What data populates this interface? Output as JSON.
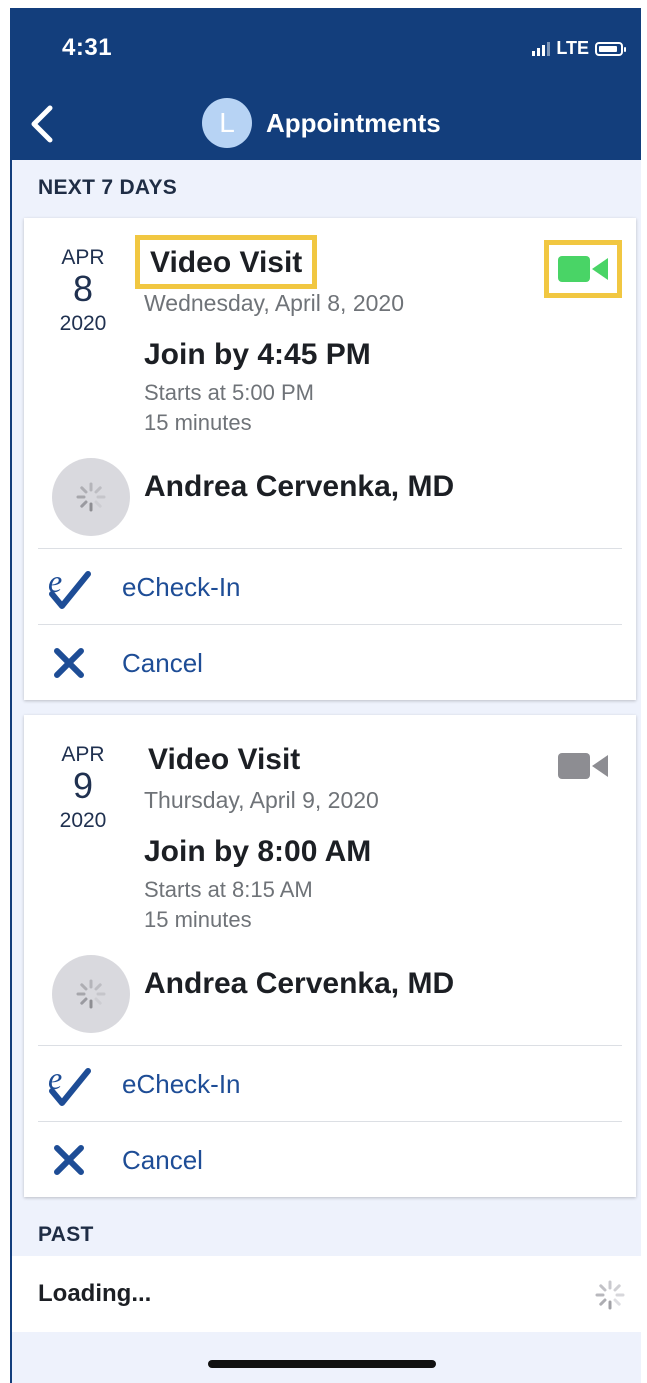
{
  "status_bar": {
    "time": "4:31",
    "network": "LTE"
  },
  "nav": {
    "avatar_letter": "L",
    "title": "Appointments"
  },
  "sections": {
    "upcoming_label": "NEXT 7 DAYS",
    "past_label": "PAST"
  },
  "appointments": [
    {
      "month": "APR",
      "day": "8",
      "year": "2020",
      "title": "Video Visit",
      "date_text": "Wednesday, April 8, 2020",
      "join_by": "Join by 4:45 PM",
      "starts": "Starts at 5:00 PM",
      "duration": "15 minutes",
      "provider": "Andrea Cervenka, MD",
      "video_active": true,
      "video_color": "#49d466",
      "actions": {
        "checkin": "eCheck-In",
        "cancel": "Cancel"
      }
    },
    {
      "month": "APR",
      "day": "9",
      "year": "2020",
      "title": "Video Visit",
      "date_text": "Thursday, April 9, 2020",
      "join_by": "Join by 8:00 AM",
      "starts": "Starts at 8:15 AM",
      "duration": "15 minutes",
      "provider": "Andrea Cervenka, MD",
      "video_active": false,
      "video_color": "#8d8d92",
      "actions": {
        "checkin": "eCheck-In",
        "cancel": "Cancel"
      }
    }
  ],
  "past": {
    "loading_text": "Loading..."
  },
  "colors": {
    "header": "#133e7c",
    "link": "#1e4d96",
    "highlight": "#f1c741",
    "background": "#eef2fc"
  }
}
